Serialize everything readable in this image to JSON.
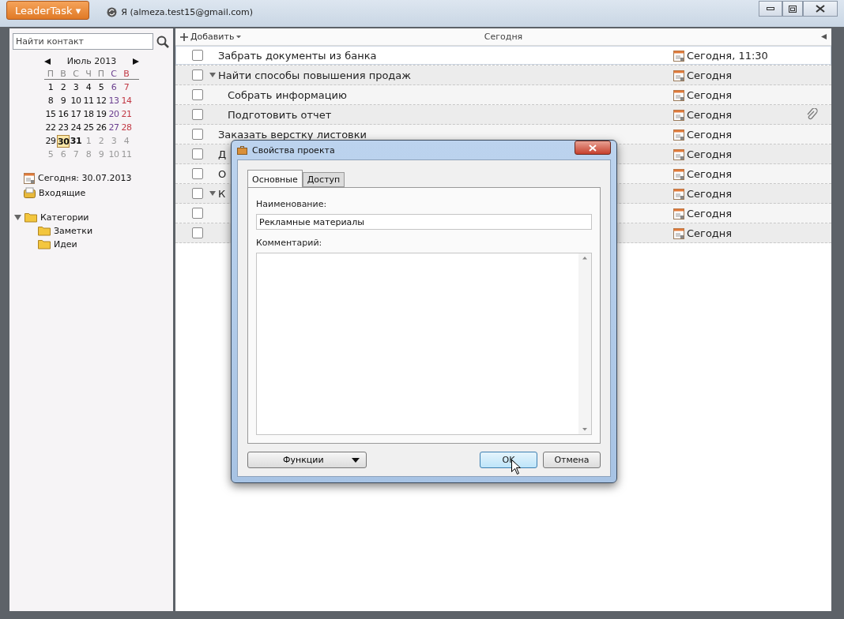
{
  "app_menu": {
    "label": "LeaderTask ▾"
  },
  "account": {
    "label": "Я (almeza.test15@gmail.com)"
  },
  "sidebar": {
    "search": {
      "placeholder": "Найти контакт"
    },
    "calendar": {
      "month": "Июль 2013",
      "weekdays": [
        {
          "label": "П",
          "kind": "day"
        },
        {
          "label": "В",
          "kind": "day"
        },
        {
          "label": "С",
          "kind": "day"
        },
        {
          "label": "Ч",
          "kind": "day"
        },
        {
          "label": "П",
          "kind": "day"
        },
        {
          "label": "С",
          "kind": "sat"
        },
        {
          "label": "В",
          "kind": "sun"
        }
      ],
      "weeks": [
        [
          {
            "d": "1",
            "kind": "day",
            "bold": false,
            "selected": false
          },
          {
            "d": "2",
            "kind": "day",
            "bold": false,
            "selected": false
          },
          {
            "d": "3",
            "kind": "day",
            "bold": false,
            "selected": false
          },
          {
            "d": "4",
            "kind": "day",
            "bold": false,
            "selected": false
          },
          {
            "d": "5",
            "kind": "day",
            "bold": false,
            "selected": false
          },
          {
            "d": "6",
            "kind": "sat",
            "bold": false,
            "selected": false
          },
          {
            "d": "7",
            "kind": "sun",
            "bold": false,
            "selected": false
          }
        ],
        [
          {
            "d": "8",
            "kind": "day",
            "bold": false,
            "selected": false
          },
          {
            "d": "9",
            "kind": "day",
            "bold": false,
            "selected": false
          },
          {
            "d": "10",
            "kind": "day",
            "bold": false,
            "selected": false
          },
          {
            "d": "11",
            "kind": "day",
            "bold": false,
            "selected": false
          },
          {
            "d": "12",
            "kind": "day",
            "bold": false,
            "selected": false
          },
          {
            "d": "13",
            "kind": "sat",
            "bold": false,
            "selected": false
          },
          {
            "d": "14",
            "kind": "sun",
            "bold": false,
            "selected": false
          }
        ],
        [
          {
            "d": "15",
            "kind": "day",
            "bold": false,
            "selected": false
          },
          {
            "d": "16",
            "kind": "day",
            "bold": false,
            "selected": false
          },
          {
            "d": "17",
            "kind": "day",
            "bold": false,
            "selected": false
          },
          {
            "d": "18",
            "kind": "day",
            "bold": false,
            "selected": false
          },
          {
            "d": "19",
            "kind": "day",
            "bold": false,
            "selected": false
          },
          {
            "d": "20",
            "kind": "sat",
            "bold": false,
            "selected": false
          },
          {
            "d": "21",
            "kind": "sun",
            "bold": false,
            "selected": false
          }
        ],
        [
          {
            "d": "22",
            "kind": "day",
            "bold": false,
            "selected": false
          },
          {
            "d": "23",
            "kind": "day",
            "bold": false,
            "selected": false
          },
          {
            "d": "24",
            "kind": "day",
            "bold": false,
            "selected": false
          },
          {
            "d": "25",
            "kind": "day",
            "bold": false,
            "selected": false
          },
          {
            "d": "26",
            "kind": "day",
            "bold": false,
            "selected": false
          },
          {
            "d": "27",
            "kind": "sat",
            "bold": false,
            "selected": false
          },
          {
            "d": "28",
            "kind": "sun",
            "bold": false,
            "selected": false
          }
        ],
        [
          {
            "d": "29",
            "kind": "day",
            "bold": false,
            "selected": false
          },
          {
            "d": "30",
            "kind": "day",
            "bold": true,
            "selected": true
          },
          {
            "d": "31",
            "kind": "day",
            "bold": true,
            "selected": false
          },
          {
            "d": "1",
            "kind": "other",
            "bold": false,
            "selected": false
          },
          {
            "d": "2",
            "kind": "other",
            "bold": false,
            "selected": false
          },
          {
            "d": "3",
            "kind": "other",
            "bold": false,
            "selected": false
          },
          {
            "d": "4",
            "kind": "other",
            "bold": false,
            "selected": false
          }
        ],
        [
          {
            "d": "5",
            "kind": "other",
            "bold": false,
            "selected": false
          },
          {
            "d": "6",
            "kind": "other",
            "bold": false,
            "selected": false
          },
          {
            "d": "7",
            "kind": "other",
            "bold": false,
            "selected": false
          },
          {
            "d": "8",
            "kind": "other",
            "bold": false,
            "selected": false
          },
          {
            "d": "9",
            "kind": "other",
            "bold": false,
            "selected": false
          },
          {
            "d": "10",
            "kind": "other",
            "bold": false,
            "selected": false
          },
          {
            "d": "11",
            "kind": "other",
            "bold": false,
            "selected": false
          }
        ]
      ]
    },
    "links": [
      {
        "label": "Сегодня: 30.07.2013",
        "kind": "today"
      },
      {
        "label": "Входящие",
        "kind": "inbox"
      }
    ],
    "categories": {
      "label": "Категории",
      "expanded": true,
      "children": [
        {
          "label": "Заметки"
        },
        {
          "label": "Идеи"
        }
      ]
    }
  },
  "toolbar": {
    "add": "Добавить",
    "title": "Сегодня"
  },
  "tasks": [
    {
      "title": "Забрать документы из банка",
      "due": "Сегодня, 11:30",
      "checked": false,
      "selected": true,
      "attachment": false
    },
    {
      "title": "Найти способы повышения продаж",
      "due": "Сегодня",
      "checked": false,
      "selected": false,
      "attachment": false,
      "expanded": true,
      "children": [
        {
          "title": "Собрать информацию",
          "due": "Сегодня",
          "checked": false,
          "selected": false,
          "attachment": false
        },
        {
          "title": "Подготовить отчет",
          "due": "Сегодня",
          "checked": false,
          "selected": false,
          "attachment": true
        }
      ]
    },
    {
      "title": "Заказать верстку листовки",
      "due": "Сегодня",
      "checked": false,
      "selected": false,
      "attachment": false
    },
    {
      "title": "Д",
      "due": "Сегодня",
      "checked": false,
      "selected": false,
      "attachment": false
    },
    {
      "title": "О",
      "due": "Сегодня",
      "checked": false,
      "selected": false,
      "attachment": false
    },
    {
      "title": "К",
      "due": "Сегодня",
      "checked": false,
      "selected": false,
      "attachment": false,
      "expanded": true,
      "children": [
        {
          "due": "Сегодня",
          "checked": false,
          "selected": false,
          "attachment": false
        },
        {
          "due": "Сегодня",
          "checked": false,
          "selected": false,
          "attachment": false
        }
      ]
    }
  ],
  "dialog": {
    "title": "Свойства проекта",
    "tabs": [
      {
        "label": "Основные",
        "selected": true
      },
      {
        "label": "Доступ",
        "selected": false
      }
    ],
    "name_label": "Наименование:",
    "name_value": "Рекламные материалы",
    "comment_label": "Комментарий:",
    "functions": "Функции",
    "ok": "OK",
    "cancel": "Отмена"
  }
}
